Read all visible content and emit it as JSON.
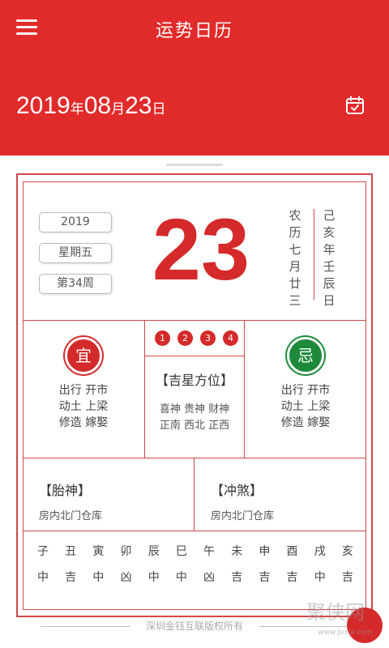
{
  "header": {
    "title": "运势日历",
    "date": {
      "year": "2019",
      "year_unit": "年",
      "month": "08",
      "month_unit": "月",
      "day": "23",
      "day_unit": "日"
    },
    "calendar_icon": "calendar-check-icon",
    "menu_icon": "hamburger-menu-icon",
    "bg_color": "#e12a2a"
  },
  "top": {
    "year": "2019",
    "weekday": "星期五",
    "week": "第34周",
    "big_day": "23",
    "lunar": [
      "农",
      "历",
      "七",
      "月",
      "廿",
      "三"
    ],
    "ganzhi": [
      "己",
      "亥",
      "年",
      "壬",
      "辰",
      "日"
    ]
  },
  "yi": {
    "badge": "宜",
    "lines": [
      "出行 开市",
      "动土 上梁",
      "修造 嫁娶"
    ]
  },
  "ji": {
    "badge": "忌",
    "lines": [
      "出行 开市",
      "动土 上梁",
      "修造 嫁娶"
    ]
  },
  "middle": {
    "numbers": [
      "1",
      "2",
      "3",
      "4"
    ],
    "title": "【吉星方位】",
    "lines": [
      "喜神 贵神 财神",
      "正南 西北 正西"
    ]
  },
  "taishen": {
    "title": "【胎神】",
    "text": "房内北门仓库"
  },
  "chongsha": {
    "title": "【冲煞】",
    "text": "房内北门仓库"
  },
  "zhi": [
    "子",
    "丑",
    "寅",
    "卯",
    "辰",
    "巳",
    "午",
    "未",
    "申",
    "酉",
    "戌",
    "亥"
  ],
  "luck": [
    "中",
    "吉",
    "中",
    "凶",
    "中",
    "中",
    "凶",
    "吉",
    "吉",
    "吉",
    "中",
    "吉"
  ],
  "footer": "深圳金钰互联版权所有",
  "watermark": {
    "text": "聚侠网",
    "url": "www.juxia.com"
  },
  "colors": {
    "accent": "#d42a2a",
    "green": "#1d8a3a"
  }
}
